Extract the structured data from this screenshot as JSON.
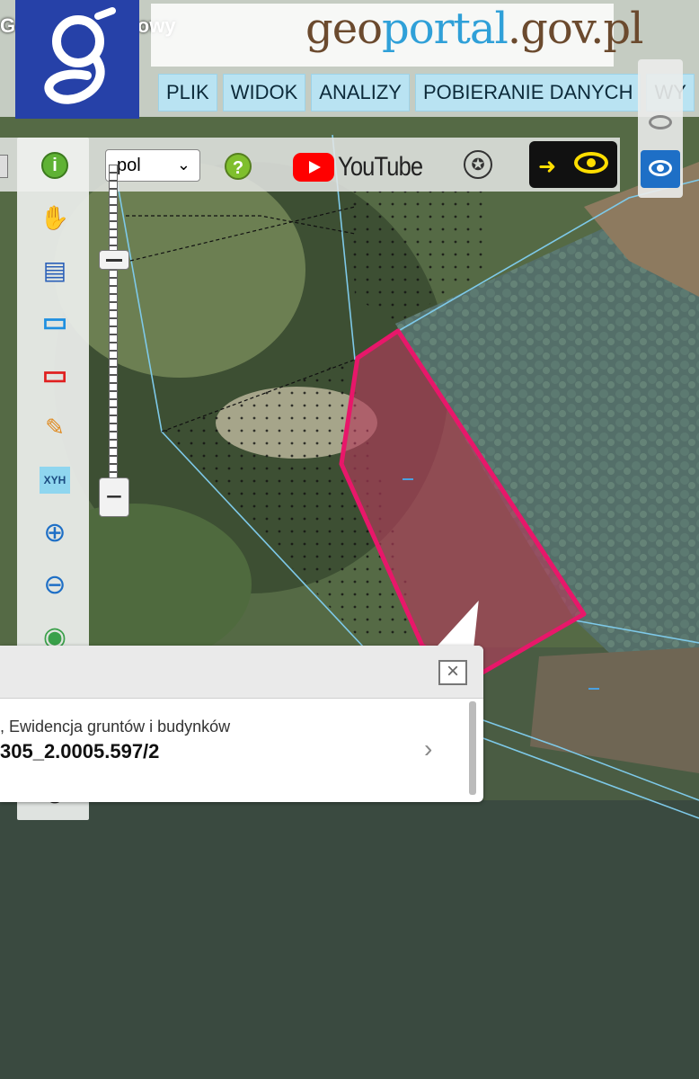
{
  "header": {
    "site_title": "Geoportal Krajowy",
    "brand_prefix": "geo",
    "brand_main": "portal",
    "brand_suffix": ".gov.pl",
    "logo_letter": "g"
  },
  "menu": {
    "items": [
      "PLIK",
      "WIDOK",
      "ANALIZY",
      "POBIERANIE DANYCH",
      "WY"
    ]
  },
  "toolbar": {
    "language": "pol",
    "help": "?",
    "youtube": "YouTube"
  },
  "tools": [
    {
      "name": "info-icon",
      "glyph": "i"
    },
    {
      "name": "pan-hand-icon",
      "glyph": "✋"
    },
    {
      "name": "legend-icon",
      "glyph": "▤"
    },
    {
      "name": "select-blue-rect-icon",
      "glyph": "▭"
    },
    {
      "name": "select-red-rect-icon",
      "glyph": "▭"
    },
    {
      "name": "pencil-icon",
      "glyph": "✎"
    },
    {
      "name": "xyh-coordinates-icon",
      "glyph": "XYH"
    },
    {
      "name": "zoom-in-icon",
      "glyph": "⊕"
    },
    {
      "name": "zoom-out-icon",
      "glyph": "⊖"
    },
    {
      "name": "globe-icon",
      "glyph": "◉"
    },
    {
      "name": "arrow-back-icon",
      "glyph": "⬅"
    },
    {
      "name": "arrow-forward-icon",
      "glyph": "➡"
    },
    {
      "name": "compass-icon",
      "glyph": "⊗"
    }
  ],
  "zoom": {
    "minus": "−",
    "level_fraction": 0.28
  },
  "popup": {
    "subtitle": ", Ewidencja gruntów i budynków",
    "parcel_id": "305_2.0005.597/2",
    "close": "×",
    "chevron": "›"
  },
  "colors": {
    "parcel_outline": "#e8176a",
    "parcel_fill": "#b03c5a",
    "boundary_lines": "#7ec9e8",
    "logo_blue": "#2641a8",
    "menu_bg": "#b9e3f2"
  }
}
